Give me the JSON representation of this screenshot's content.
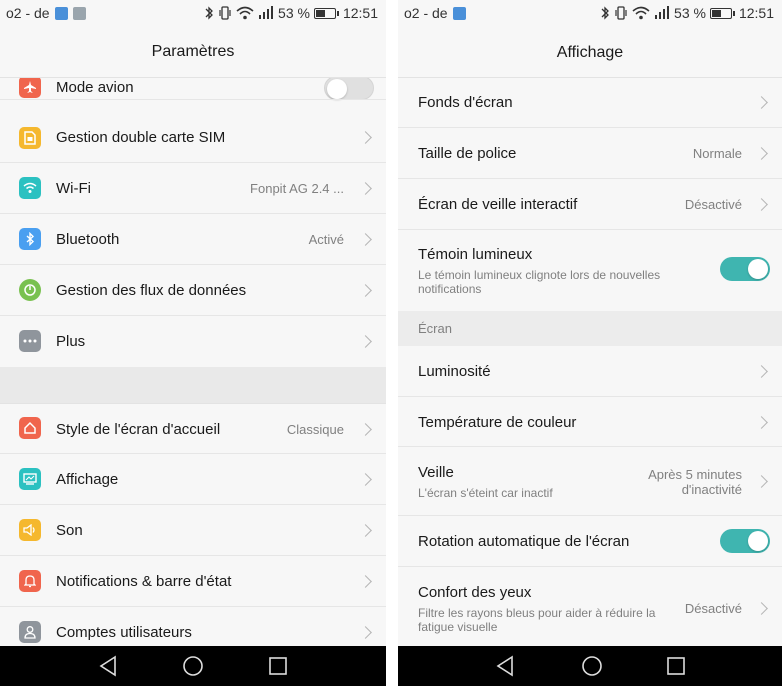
{
  "status_left": {
    "carrier": "o2 - de",
    "battery_percent": "53 %",
    "time": "12:51",
    "battery_level": 0.53
  },
  "status_right": {
    "carrier": "o2 - de",
    "battery_percent": "53 %",
    "time": "12:51",
    "battery_level": 0.53
  },
  "left": {
    "title": "Paramètres",
    "items": [
      {
        "label": "Mode avion",
        "icon": "airplane-icon",
        "color": "#f0654d",
        "toggle": "off"
      },
      {
        "label": "Gestion double carte SIM",
        "icon": "sim-card-icon",
        "color": "#f5b82e"
      },
      {
        "label": "Wi-Fi",
        "value": "Fonpit AG 2.4 ...",
        "icon": "wifi-icon",
        "color": "#2cc1c1"
      },
      {
        "label": "Bluetooth",
        "value": "Activé",
        "icon": "bluetooth-icon",
        "color": "#4a9ff0"
      },
      {
        "label": "Gestion des flux de données",
        "icon": "data-usage-icon",
        "color": "#79c150"
      },
      {
        "label": "Plus",
        "icon": "more-icon",
        "color": "#8f959c"
      },
      {
        "label": "Style de l'écran d'accueil",
        "value": "Classique",
        "icon": "home-icon",
        "color": "#f0654d"
      },
      {
        "label": "Affichage",
        "icon": "display-icon",
        "color": "#2cc1c1"
      },
      {
        "label": "Son",
        "icon": "sound-icon",
        "color": "#f5b82e"
      },
      {
        "label": "Notifications & barre d'état",
        "icon": "bell-icon",
        "color": "#f0654d"
      },
      {
        "label": "Comptes utilisateurs",
        "icon": "user-icon",
        "color": "#8f959c"
      }
    ]
  },
  "right": {
    "title": "Affichage",
    "items": {
      "wallpaper": {
        "label": "Fonds d'écran"
      },
      "font_size": {
        "label": "Taille de police",
        "value": "Normale"
      },
      "daydream": {
        "label": "Écran de veille interactif",
        "value": "Désactivé"
      },
      "led": {
        "label": "Témoin lumineux",
        "sub": "Le témoin lumineux clignote lors de nouvelles notifications",
        "toggle": "on"
      },
      "section": "Écran",
      "brightness": {
        "label": "Luminosité"
      },
      "color_temp": {
        "label": "Température de couleur"
      },
      "sleep": {
        "label": "Veille",
        "sub": "L'écran s'éteint car inactif",
        "value_line1": "Après 5 minutes",
        "value_line2": "d'inactivité"
      },
      "rotation": {
        "label": "Rotation automatique de l'écran",
        "toggle": "on"
      },
      "eye_comfort": {
        "label": "Confort des yeux",
        "sub_line1": "Filtre les rayons bleus pour aider à réduire la",
        "sub_line2": "fatigue visuelle",
        "value": "Désactivé"
      }
    }
  },
  "colors": {
    "accent_toggle": "#3fb5b0",
    "navbar": "#000000"
  }
}
